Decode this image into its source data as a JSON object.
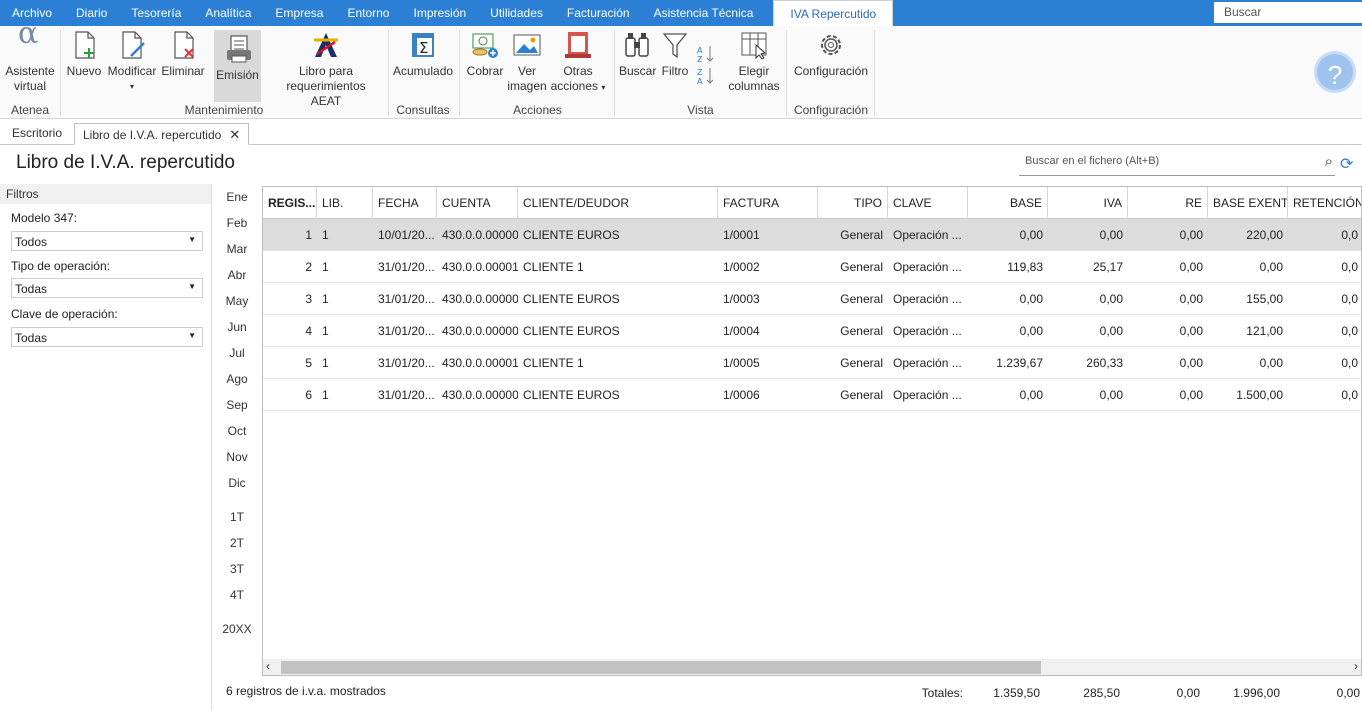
{
  "menu": {
    "items": [
      "Archivo",
      "Diario",
      "Tesorería",
      "Analítica",
      "Empresa",
      "Entorno",
      "Impresión",
      "Utilidades",
      "Facturación",
      "Asistencia Técnica"
    ],
    "active": "IVA Repercutido",
    "search_placeholder": "Buscar"
  },
  "ribbon": {
    "asistente": "Asistente virtual",
    "asistente_l1": "Asistente",
    "asistente_l2": "virtual",
    "nuevo": "Nuevo",
    "modificar": "Modificar",
    "eliminar": "Eliminar",
    "emision": "Emisión",
    "libro_l1": "Libro para",
    "libro_l2": "requerimientos AEAT",
    "acumulado": "Acumulado",
    "cobrar": "Cobrar",
    "ver_l1": "Ver",
    "ver_l2": "imagen",
    "otras_l1": "Otras",
    "otras_l2": "acciones",
    "buscar": "Buscar",
    "filtro": "Filtro",
    "elegir_l1": "Elegir",
    "elegir_l2": "columnas",
    "configuracion": "Configuración",
    "groups": {
      "atenea": "Atenea",
      "mantenimiento": "Mantenimiento",
      "consultas": "Consultas",
      "acciones": "Acciones",
      "vista": "Vista",
      "configuracion": "Configuración"
    }
  },
  "tabs": {
    "escritorio": "Escritorio",
    "libro": "Libro de I.V.A. repercutido"
  },
  "page": {
    "title": "Libro de I.V.A. repercutido",
    "search_placeholder": "Buscar en el fichero (Alt+B)"
  },
  "filters": {
    "title": "Filtros",
    "modelo_label": "Modelo 347:",
    "modelo_value": "Todos",
    "tipo_label": "Tipo de operación:",
    "tipo_value": "Todas",
    "clave_label": "Clave de operación:",
    "clave_value": "Todas"
  },
  "months": [
    "Ene",
    "Feb",
    "Mar",
    "Abr",
    "May",
    "Jun",
    "Jul",
    "Ago",
    "Sep",
    "Oct",
    "Nov",
    "Dic"
  ],
  "quarters": [
    "1T",
    "2T",
    "3T",
    "4T"
  ],
  "year": "20XX",
  "table": {
    "headers": [
      "REGIS...",
      "LIB.",
      "FECHA",
      "CUENTA",
      "CLIENTE/DEUDOR",
      "FACTURA",
      "TIPO",
      "CLAVE",
      "BASE",
      "IVA",
      "RE",
      "BASE EXENTA",
      "RETENCIÓN"
    ],
    "rows": [
      [
        "1",
        "1",
        "10/01/20...",
        "430.0.0.00000",
        "CLIENTE EUROS",
        "1/0001",
        "General",
        "Operación ...",
        "0,00",
        "0,00",
        "0,00",
        "220,00",
        "0,0"
      ],
      [
        "2",
        "1",
        "31/01/20...",
        "430.0.0.00001",
        "CLIENTE 1",
        "1/0002",
        "General",
        "Operación ...",
        "119,83",
        "25,17",
        "0,00",
        "0,00",
        "0,0"
      ],
      [
        "3",
        "1",
        "31/01/20...",
        "430.0.0.00000",
        "CLIENTE EUROS",
        "1/0003",
        "General",
        "Operación ...",
        "0,00",
        "0,00",
        "0,00",
        "155,00",
        "0,0"
      ],
      [
        "4",
        "1",
        "31/01/20...",
        "430.0.0.00000",
        "CLIENTE EUROS",
        "1/0004",
        "General",
        "Operación ...",
        "0,00",
        "0,00",
        "0,00",
        "121,00",
        "0,0"
      ],
      [
        "5",
        "1",
        "31/01/20...",
        "430.0.0.00001",
        "CLIENTE 1",
        "1/0005",
        "General",
        "Operación ...",
        "1.239,67",
        "260,33",
        "0,00",
        "0,00",
        "0,0"
      ],
      [
        "6",
        "1",
        "31/01/20...",
        "430.0.0.00000",
        "CLIENTE EUROS",
        "1/0006",
        "General",
        "Operación ...",
        "0,00",
        "0,00",
        "0,00",
        "1.500,00",
        "0,0"
      ]
    ]
  },
  "footer": {
    "status": "6 registros de i.v.a. mostrados",
    "totales_label": "Totales:",
    "base": "1.359,50",
    "iva": "285,50",
    "re": "0,00",
    "base_exenta": "1.996,00",
    "retencion": "0,00"
  },
  "colors": {
    "menubar": "#2b7fd4",
    "accent": "#2b6cb8",
    "selected_row": "#dcdcdc"
  }
}
